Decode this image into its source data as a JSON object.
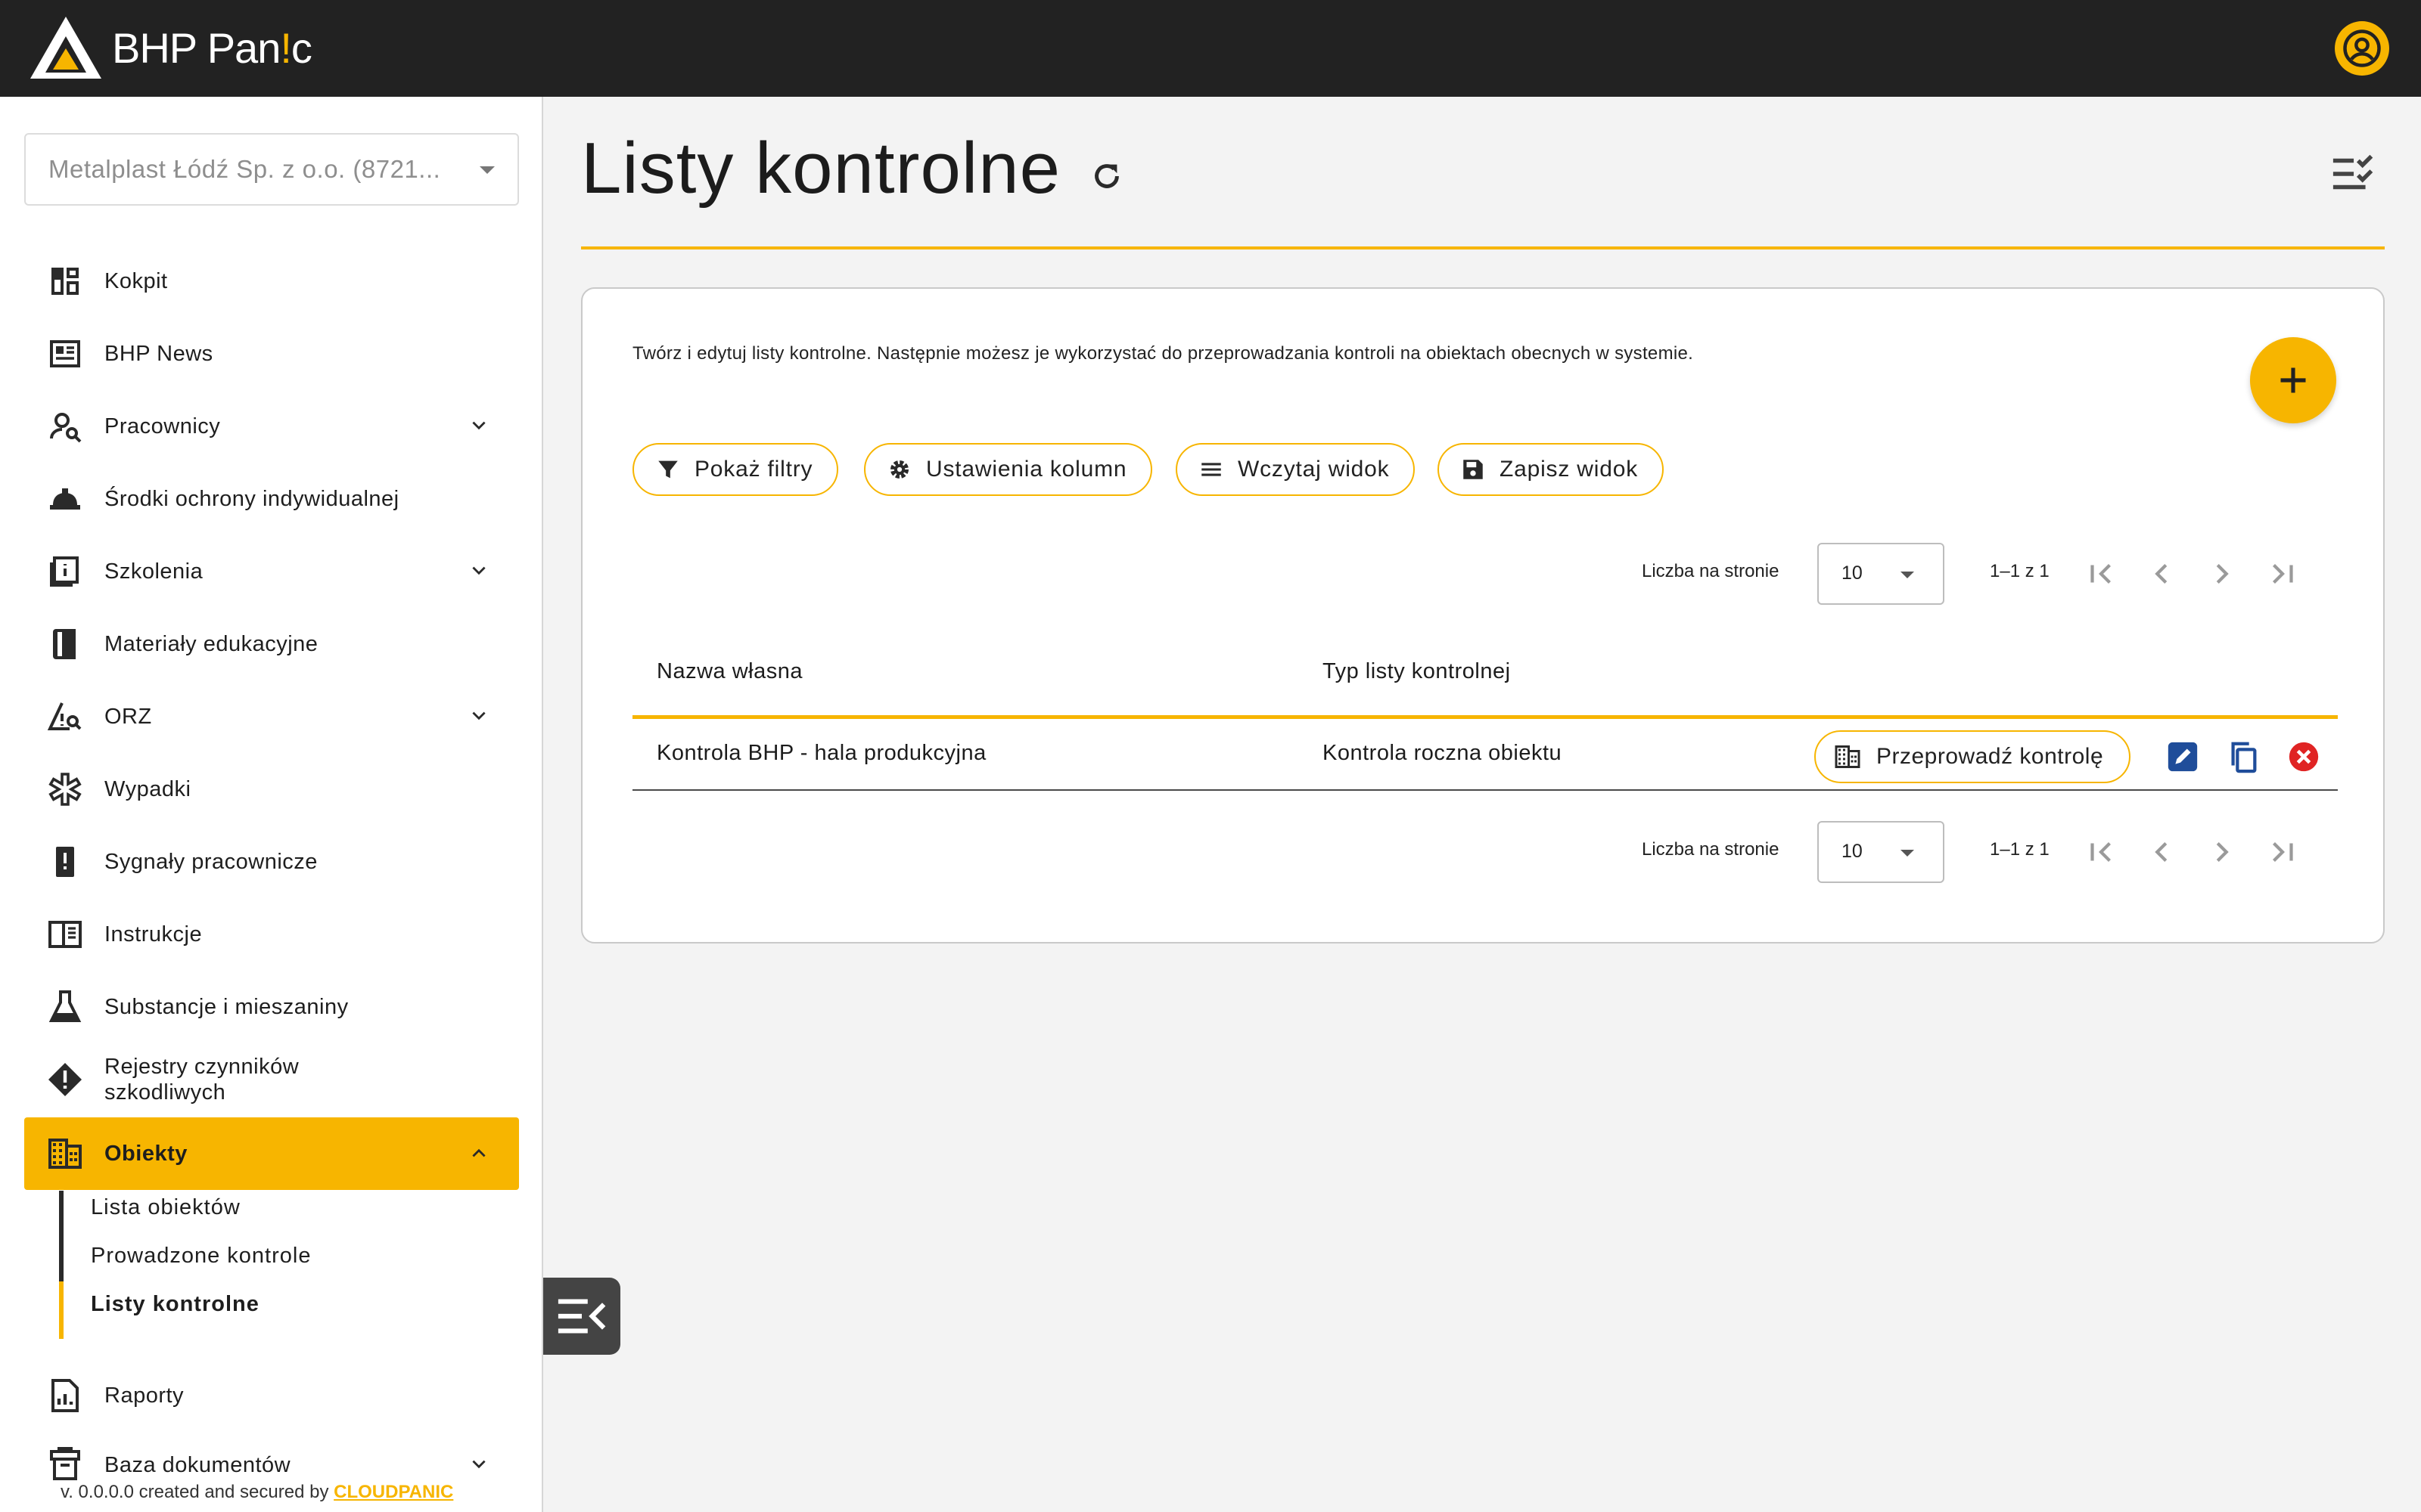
{
  "app": {
    "brand_main": "BHP Pan",
    "brand_accent": "!",
    "brand_end": "c",
    "accent_color": "#f7b500",
    "topbar_color": "#222222"
  },
  "sidebar": {
    "company": "Metalplast Łódź Sp. z o.o. (8721...",
    "items": [
      {
        "label": "Kokpit",
        "icon": "dashboard-icon"
      },
      {
        "label": "BHP News",
        "icon": "newspaper-icon"
      },
      {
        "label": "Pracownicy",
        "icon": "person-search-icon"
      },
      {
        "label": "Środki ochrony indywidualnej",
        "icon": "hard-hat-icon"
      },
      {
        "label": "Szkolenia",
        "icon": "training-book-icon"
      },
      {
        "label": "Materiały edukacyjne",
        "icon": "book-icon"
      },
      {
        "label": "ORZ",
        "icon": "risk-warning-icon"
      },
      {
        "label": "Wypadki",
        "icon": "medical-star-icon"
      },
      {
        "label": "Sygnały pracownicze",
        "icon": "signal-icon"
      },
      {
        "label": "Instrukcje",
        "icon": "instructions-icon"
      },
      {
        "label": "Substancje i mieszaniny",
        "icon": "flask-icon"
      },
      {
        "label": "Rejestry czynników szkodliwych",
        "icon": "hazard-icon"
      },
      {
        "label": "Obiekty",
        "icon": "building-icon"
      },
      {
        "label": "Raporty",
        "icon": "report-icon"
      },
      {
        "label": "Baza dokumentów",
        "icon": "archive-icon"
      }
    ],
    "subitems": [
      "Lista obiektów",
      "Prowadzone kontrole",
      "Listy kontrolne"
    ],
    "version_text": "v. 0.0.0.0 created and secured by ",
    "version_brand": "CLOUDPANIC"
  },
  "main": {
    "title": "Listy kontrolne",
    "description": "Twórz i edytuj listy kontrolne. Następnie możesz je wykorzystać do przeprowadzania kontroli na obiektach obecnych w systemie.",
    "toolbar": {
      "filters": "Pokaż filtry",
      "columns": "Ustawienia kolumn",
      "load_view": "Wczytaj widok",
      "save_view": "Zapisz widok"
    },
    "pager": {
      "per_page_label": "Liczba na stronie",
      "per_page_value": "10",
      "range": "1–1 z 1"
    },
    "table": {
      "columns": [
        "Nazwa własna",
        "Typ listy kontrolnej"
      ],
      "rows": [
        {
          "name": "Kontrola BHP - hala produkcyjna",
          "type": "Kontrola roczna obiektu",
          "action": "Przeprowadź kontrolę"
        }
      ]
    }
  }
}
